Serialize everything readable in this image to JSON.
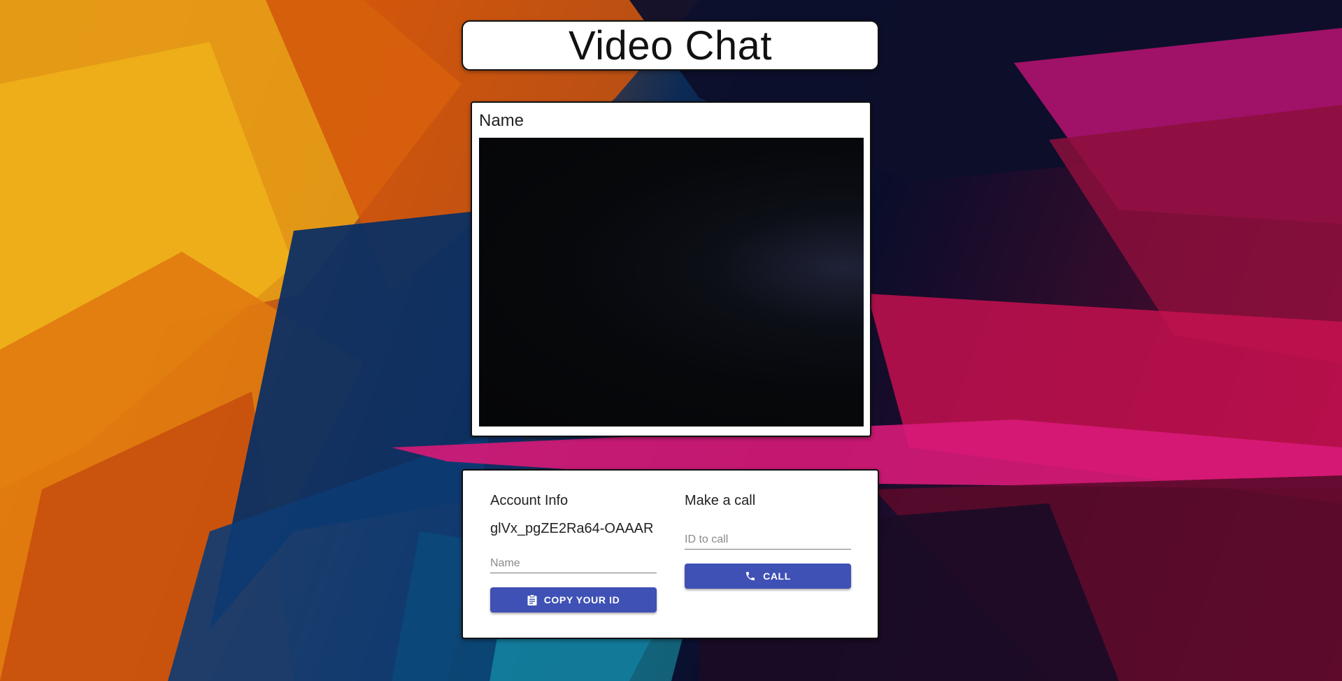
{
  "app": {
    "title": "Video Chat"
  },
  "video": {
    "name_label": "Name"
  },
  "account": {
    "heading": "Account Info",
    "id": "glVx_pgZE2Ra64-OAAAR",
    "name_placeholder": "Name",
    "name_value": "",
    "copy_button_label": "COPY YOUR ID",
    "copy_icon": "clipboard-icon"
  },
  "call": {
    "heading": "Make a call",
    "id_placeholder": "ID to call",
    "id_value": "",
    "call_button_label": "CALL",
    "call_icon": "phone-icon"
  },
  "colors": {
    "primary": "#3f51b5",
    "card_bg": "#ffffff",
    "video_bg": "#07080b"
  }
}
